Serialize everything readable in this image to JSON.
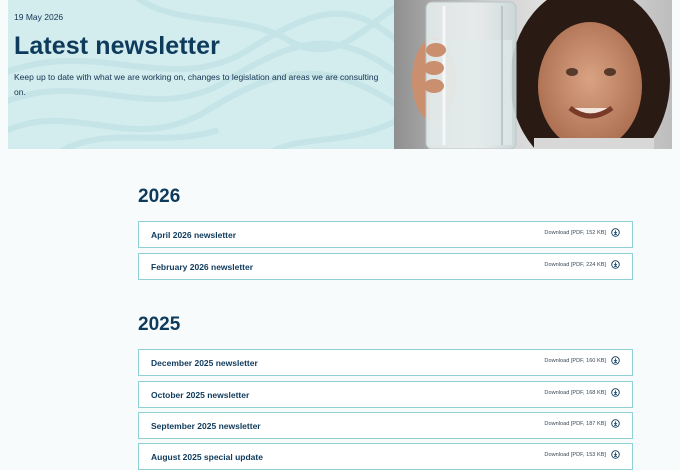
{
  "hero": {
    "date": "19 May 2026",
    "title": "Latest newsletter",
    "description": "Keep up to date with what we are working on, changes to legislation and areas we are consulting on."
  },
  "sections": [
    {
      "year": "2026",
      "items": [
        {
          "title": "April 2026 newsletter",
          "download": "Download [PDF, 152 KB]"
        },
        {
          "title": "February 2026 newsletter",
          "download": "Download [PDF, 224 KB]"
        }
      ]
    },
    {
      "year": "2025",
      "items": [
        {
          "title": "December 2025 newsletter",
          "download": "Download [PDF, 160 KB]"
        },
        {
          "title": "October 2025 newsletter",
          "download": "Download [PDF, 168 KB]"
        },
        {
          "title": "September 2025 newsletter",
          "download": "Download [PDF, 187 KB]"
        },
        {
          "title": "August 2025 special update",
          "download": "Download [PDF, 153 KB]"
        }
      ]
    }
  ],
  "colors": {
    "hero_background": "#d3ecee",
    "heading": "#0e3a5c",
    "item_border": "#8ed2d6"
  },
  "icons": {
    "download": "download-circle-icon"
  }
}
